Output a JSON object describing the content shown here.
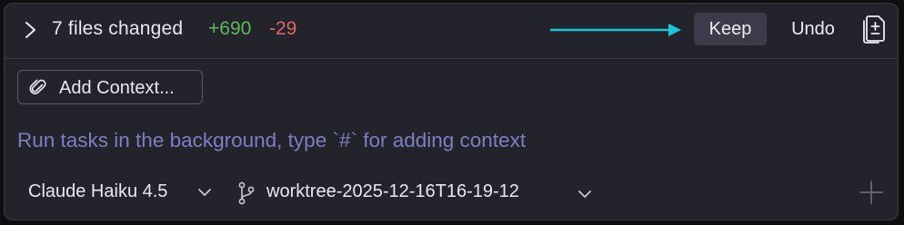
{
  "changes": {
    "summary": "7 files changed",
    "additions": "+690",
    "deletions": "-29",
    "keep_label": "Keep",
    "undo_label": "Undo"
  },
  "context": {
    "add_label": "Add Context..."
  },
  "prompt": {
    "placeholder": "Run tasks in the background, type `#` for adding context"
  },
  "footer": {
    "model": "Claude Haiku 4.5",
    "branch": "worktree-2025-12-16T16-19-12"
  },
  "colors": {
    "additions": "#5fb85f",
    "deletions": "#e06666",
    "placeholder": "#7c7fc2",
    "annotation_arrow": "#19c6dc"
  },
  "icons": [
    "chevron-right-icon",
    "annotation-arrow-icon",
    "diff-document-icon",
    "paperclip-icon",
    "chevron-down-icon",
    "git-branch-icon",
    "plus-icon"
  ]
}
